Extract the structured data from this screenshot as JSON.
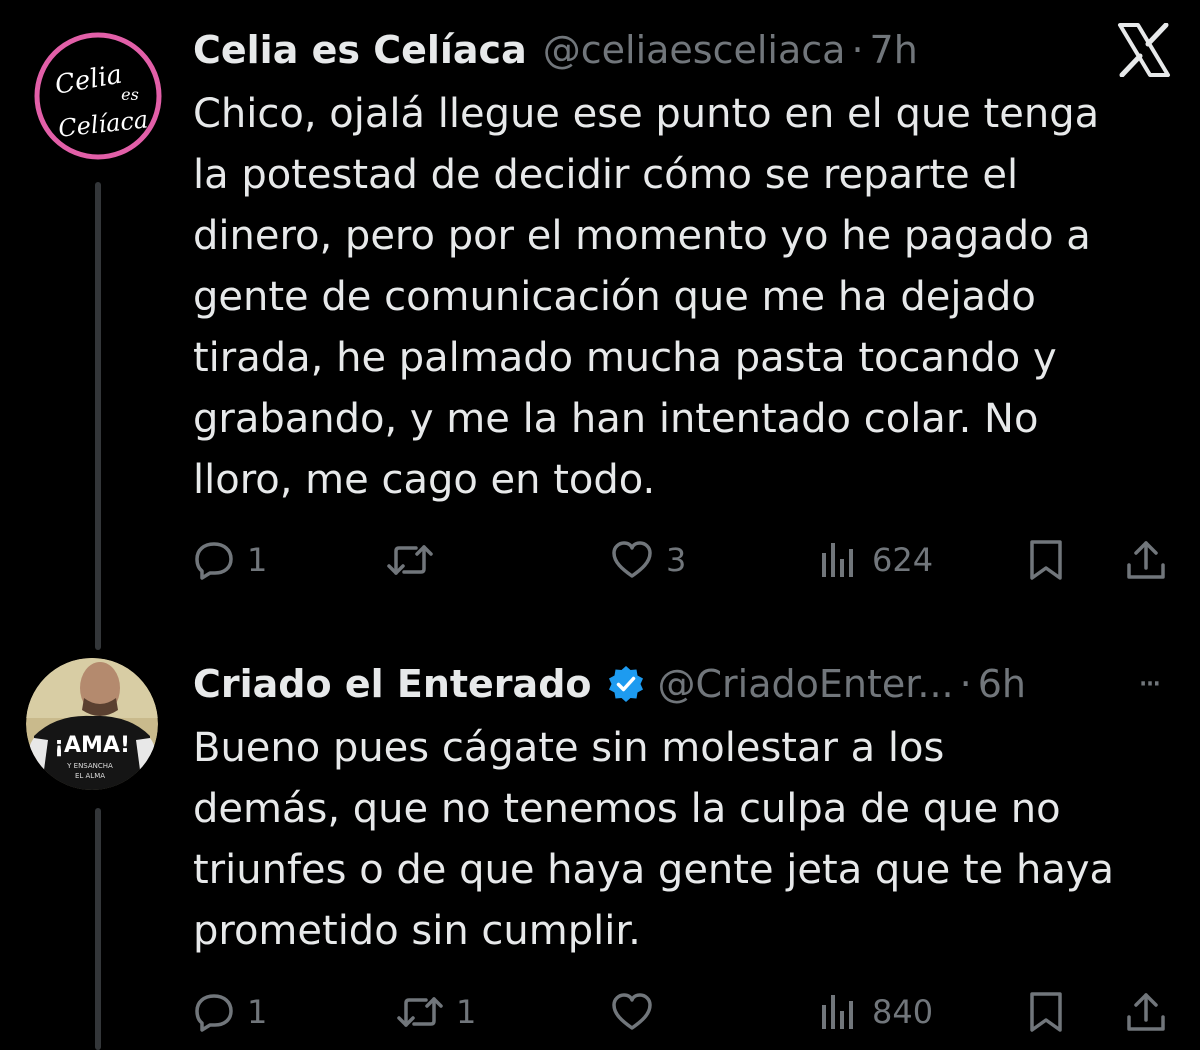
{
  "x_logo": "X",
  "colors": {
    "background": "#000000",
    "text_primary": "#e7e9ea",
    "text_secondary": "#71767b",
    "verified_badge": "#1d9bf0",
    "thread_line": "#333639"
  },
  "tweets": [
    {
      "author": {
        "name": "Celia es Celíaca",
        "handle": "@celiaesceliaca",
        "avatar_text": [
          "Celia",
          "es",
          "Celíaca"
        ]
      },
      "separator": "·",
      "time": "7h",
      "lines": [
        "Chico, ojalá llegue ese punto en el que tenga",
        "la potestad de decidir cómo se reparte el",
        "dinero, pero por el momento yo he pagado a",
        "gente de comunicación que me ha dejado",
        "tirada, he palmado mucha pasta tocando y",
        "grabando, y me la han intentado colar. No",
        "lloro, me cago en todo."
      ],
      "actions": {
        "replies": "1",
        "retweets": "",
        "likes": "3",
        "views": "624"
      },
      "icons": [
        "reply-icon",
        "retweet-icon",
        "like-icon",
        "views-icon",
        "bookmark-icon",
        "share-icon"
      ]
    },
    {
      "author": {
        "name": "Criado el Enterado",
        "handle": "@CriadoEnter...",
        "verified": true,
        "avatar_text": [
          "¡AMA!",
          "Y ENSANCHA",
          "EL ALMA"
        ]
      },
      "separator": "·",
      "time": "6h",
      "more": "···",
      "lines": [
        "Bueno pues cágate sin molestar a los",
        "demás, que no tenemos la culpa de que no",
        "triunfes o de que haya gente jeta que te haya",
        "prometido sin cumplir."
      ],
      "actions": {
        "replies": "1",
        "retweets": "1",
        "likes": "",
        "views": "840"
      },
      "icons": [
        "reply-icon",
        "retweet-icon",
        "like-icon",
        "views-icon",
        "bookmark-icon",
        "share-icon"
      ]
    }
  ]
}
